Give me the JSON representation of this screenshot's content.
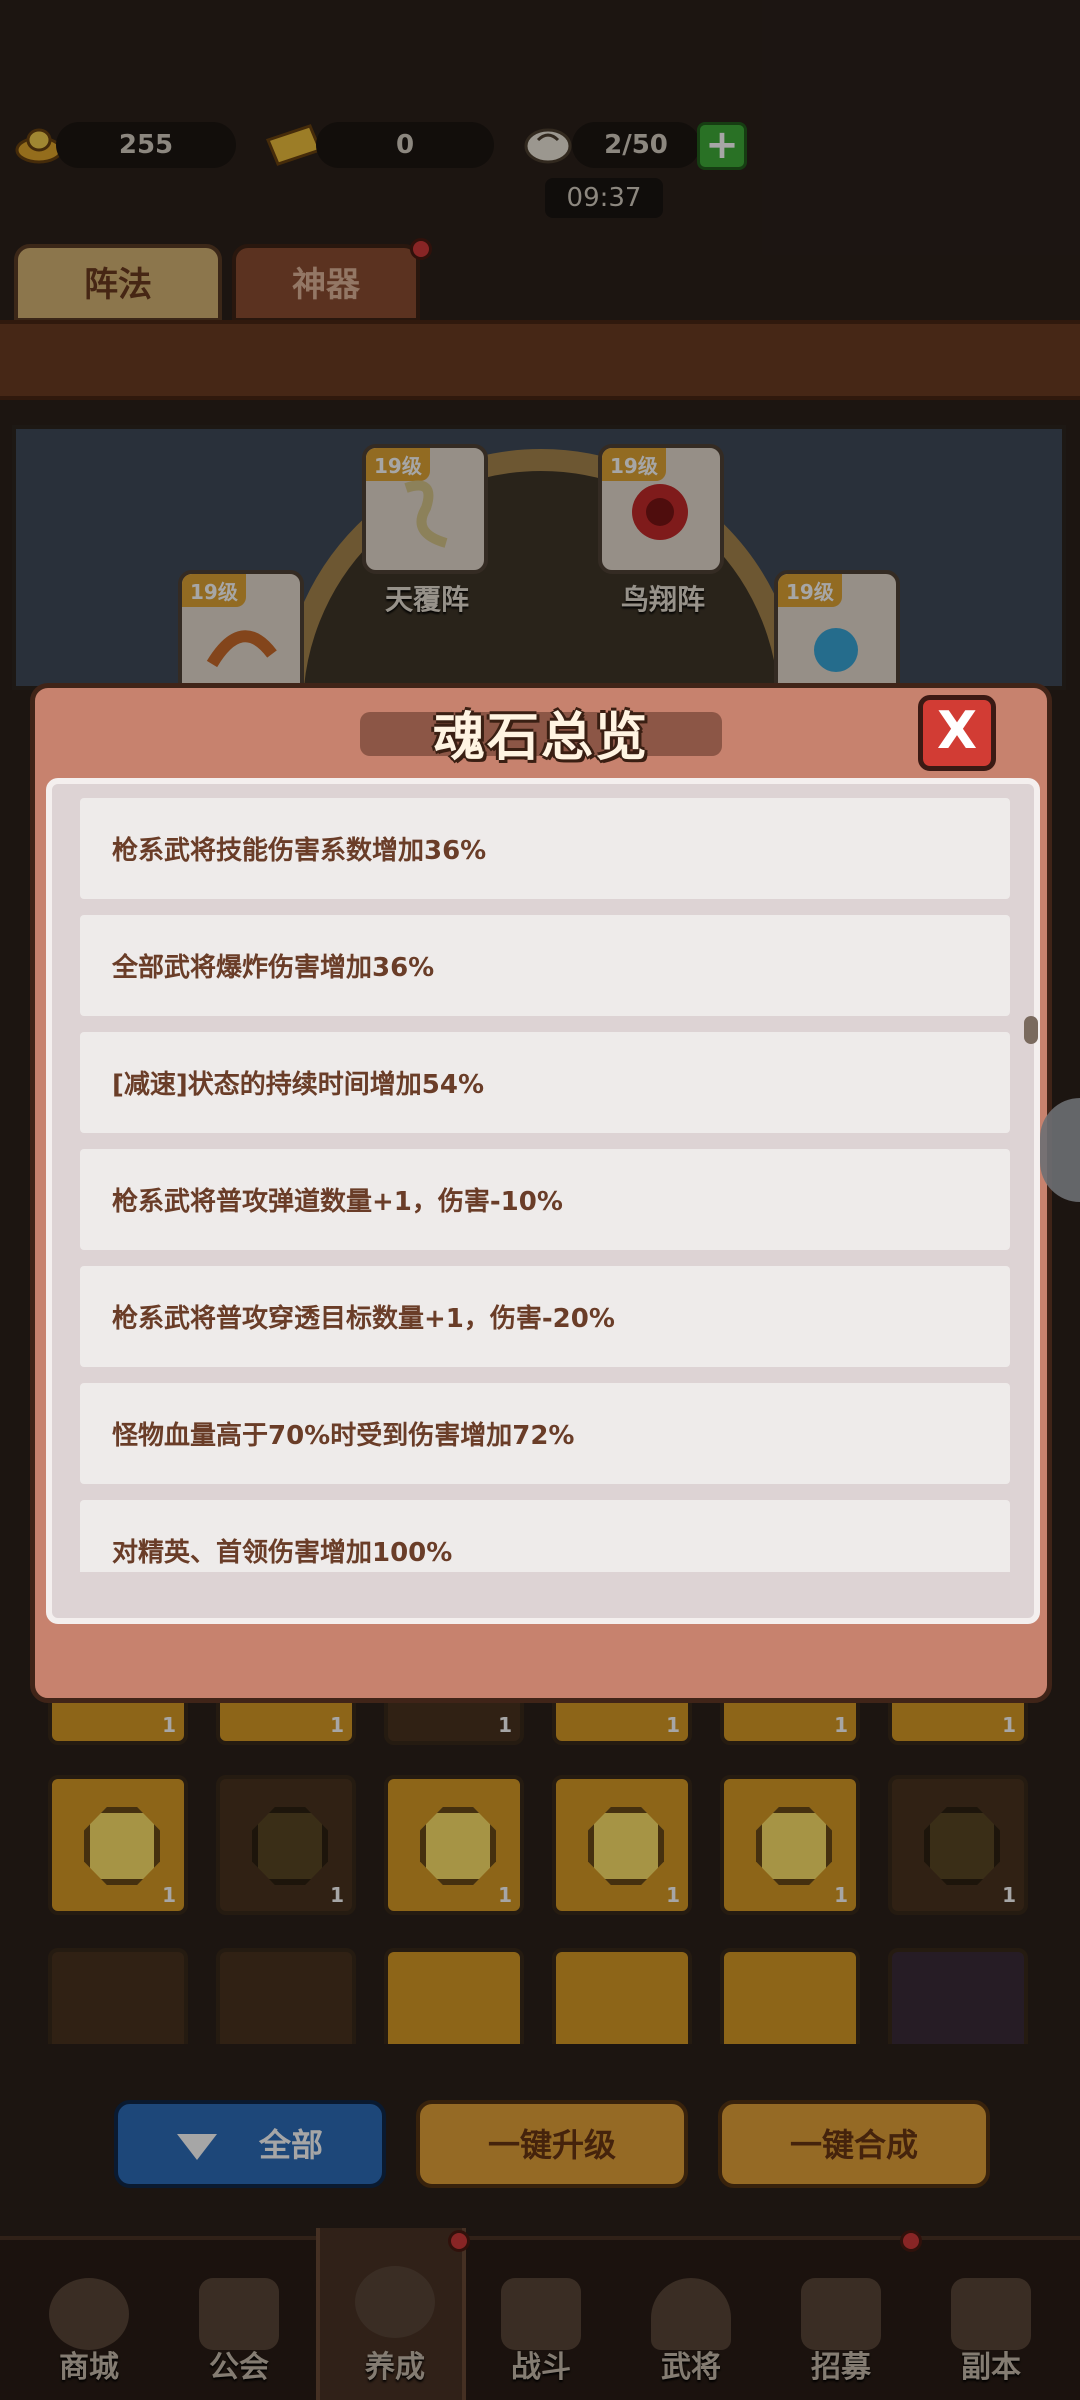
{
  "status": {
    "gold": "255",
    "ticket": "0",
    "stamina": "2/50",
    "timer": "09:37",
    "plus_icon": "plus-icon"
  },
  "tabs": [
    {
      "label": "阵法"
    },
    {
      "label": "神器"
    }
  ],
  "formations": [
    {
      "level": "19级",
      "name": "天覆阵"
    },
    {
      "level": "19级",
      "name": "鸟翔阵"
    },
    {
      "level": "19级",
      "name": ""
    },
    {
      "level": "19级",
      "name": ""
    }
  ],
  "modal": {
    "title": "魂石总览",
    "close_label": "X",
    "items": [
      "枪系武将技能伤害系数增加36%",
      "全部武将爆炸伤害增加36%",
      "[减速]状态的持续时间增加54%",
      "枪系武将普攻弹道数量+1，伤害-10%",
      "枪系武将普攻穿透目标数量+1，伤害-20%",
      "怪物血量高于70%时受到伤害增加72%",
      "对精英、首领伤害增加100%"
    ]
  },
  "slot_counts": [
    "1",
    "1",
    "1",
    "1",
    "1",
    "1",
    "1",
    "1",
    "1",
    "1",
    "1",
    "1"
  ],
  "buttons": {
    "filter": "全部",
    "upgrade_all": "一键升级",
    "merge_all": "一键合成"
  },
  "nav": [
    {
      "label": "商城",
      "icon": "shop-icon"
    },
    {
      "label": "公会",
      "icon": "guild-icon"
    },
    {
      "label": "养成",
      "icon": "cultivate-icon"
    },
    {
      "label": "战斗",
      "icon": "battle-icon"
    },
    {
      "label": "武将",
      "icon": "general-icon"
    },
    {
      "label": "招募",
      "icon": "recruit-icon"
    },
    {
      "label": "副本",
      "icon": "dungeon-icon"
    }
  ],
  "colors": {
    "modal_bg": "#c7826e",
    "row_text": "#6a3d28",
    "gold_slot": "#d99b25",
    "close_red": "#d23c34"
  }
}
